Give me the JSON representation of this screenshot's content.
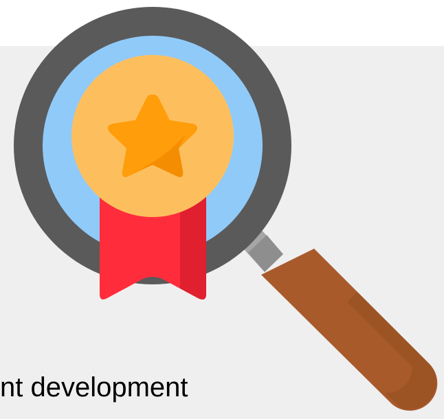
{
  "caption": {
    "text": "nt development"
  },
  "illustration": {
    "icon": "magnifier-award-icon",
    "colors": {
      "panel_background": "#efefef",
      "lens_rim": "#5a5a5a",
      "lens_glass": "#90caf9",
      "medal": "#fdbf5e",
      "star": "#ff9d0a",
      "ribbon": "#ff2d3c",
      "neck": "#a6a6a6",
      "handle": "#a85a2b"
    }
  }
}
